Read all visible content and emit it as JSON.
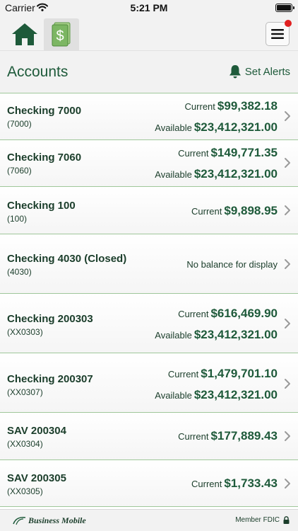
{
  "status_bar": {
    "carrier": "Carrier",
    "time": "5:21 PM"
  },
  "nav": {
    "menu_badge_color": "#e02020"
  },
  "header": {
    "title": "Accounts",
    "alerts_label": "Set Alerts"
  },
  "accounts": [
    {
      "name": "Checking 7000",
      "number": "(7000)",
      "current_label": "Current",
      "current": "$99,382.18",
      "available_label": "Available",
      "available": "$23,412,321.00"
    },
    {
      "name": "Checking 7060",
      "number": "(7060)",
      "current_label": "Current",
      "current": "$149,771.35",
      "available_label": "Available",
      "available": "$23,412,321.00"
    },
    {
      "name": "Checking 100",
      "number": "(100)",
      "current_label": "Current",
      "current": "$9,898.95"
    },
    {
      "name": "Checking 4030 (Closed)",
      "number": "(4030)",
      "message": "No balance for display"
    },
    {
      "name": "Checking 200303",
      "number": "(XX0303)",
      "current_label": "Current",
      "current": "$616,469.90",
      "available_label": "Available",
      "available": "$23,412,321.00"
    },
    {
      "name": "Checking 200307",
      "number": "(XX0307)",
      "current_label": "Current",
      "current": "$1,479,701.10",
      "available_label": "Available",
      "available": "$23,412,321.00"
    },
    {
      "name": "SAV 200304",
      "number": "(XX0304)",
      "current_label": "Current",
      "current": "$177,889.43"
    },
    {
      "name": "SAV 200305",
      "number": "(XX0305)",
      "current_label": "Current",
      "current": "$1,733.43"
    }
  ],
  "footer": {
    "brand": "Business Mobile",
    "fdic": "Member FDIC"
  },
  "colors": {
    "brand_green": "#1e5a3a",
    "divider": "#9fc79a",
    "chevron": "#9a9a9a"
  }
}
